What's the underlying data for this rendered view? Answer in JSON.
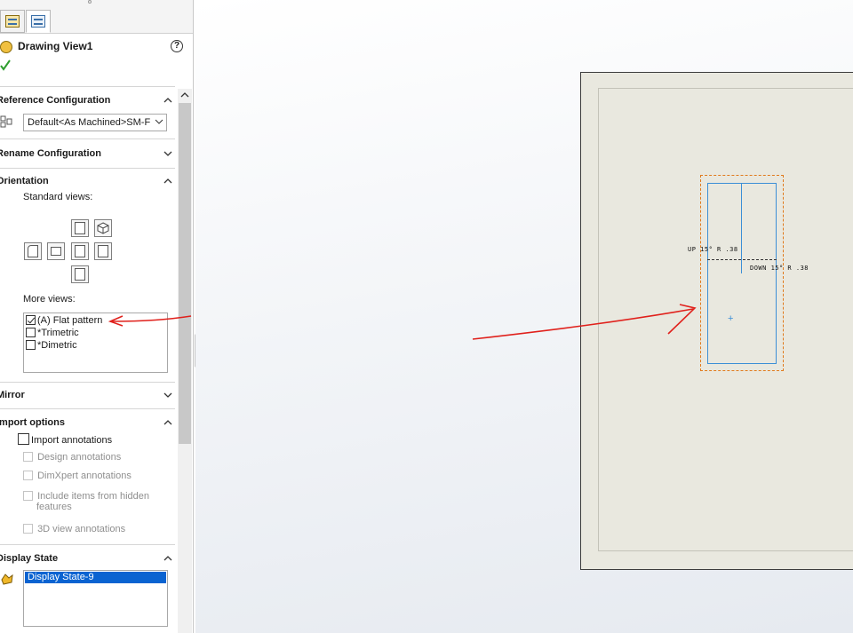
{
  "panel": {
    "title": "Drawing View1",
    "help_glyph": "?",
    "sections": {
      "reference_configuration": {
        "title": "Reference Configuration",
        "selected": "Default<As Machined>SM-F"
      },
      "rename_configuration": {
        "title": "Rename Configuration"
      },
      "orientation": {
        "title": "Orientation",
        "standard_views_label": "Standard views:",
        "more_views_label": "More views:",
        "more_views": [
          {
            "label": "(A) Flat pattern",
            "checked": true
          },
          {
            "label": "*Trimetric",
            "checked": false
          },
          {
            "label": "*Dimetric",
            "checked": false
          }
        ]
      },
      "mirror": {
        "title": "Mirror"
      },
      "import_options": {
        "title": "Import options",
        "import_annotations": "Import annotations",
        "design_annotations": "Design annotations",
        "dimxpert_annotations": "DimXpert annotations",
        "include_hidden_1": "Include items from hidden",
        "include_hidden_2": "features",
        "view_3d_annotations": "3D view annotations"
      },
      "display_state": {
        "title": "Display State",
        "selected": "Display State-9"
      }
    }
  },
  "drawing": {
    "bend_up": "UP 15° R .38",
    "bend_down": "DOWN 15° R .38",
    "origin_glyph": "+"
  },
  "colors": {
    "selection": "#0a63d1",
    "annotation_arrow": "#e0201b",
    "part_edge": "#3c8fd6",
    "view_boundary": "#e07a1c",
    "sheet": "#e9e8df"
  }
}
